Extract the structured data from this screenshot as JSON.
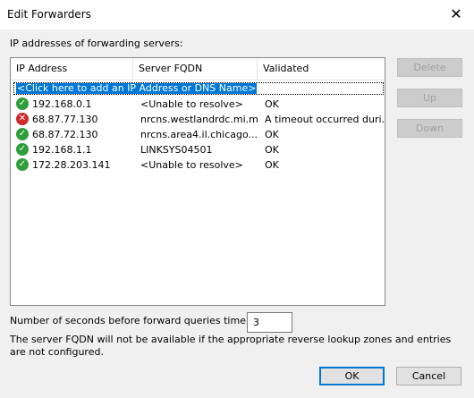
{
  "window": {
    "title": "Edit Forwarders",
    "close_glyph": "✕"
  },
  "caption": "IP addresses of forwarding servers:",
  "columns": [
    "IP Address",
    "Server FQDN",
    "Validated"
  ],
  "add_row": "<Click here to add an IP Address or DNS Name>",
  "rows": [
    {
      "status": "ok-icon",
      "ip": "192.168.0.1",
      "fqdn": "<Unable to resolve>",
      "validated": "OK"
    },
    {
      "status": "error-icon",
      "ip": "68.87.77.130",
      "fqdn": "nrcns.westlandrdc.mi.m...",
      "validated": "A timeout occurred duri..."
    },
    {
      "status": "ok-icon",
      "ip": "68.87.72.130",
      "fqdn": "nrcns.area4.il.chicago....",
      "validated": "OK"
    },
    {
      "status": "ok-icon",
      "ip": "192.168.1.1",
      "fqdn": "LINKSYS04501",
      "validated": "OK"
    },
    {
      "status": "ok-icon",
      "ip": "172.28.203.141",
      "fqdn": "<Unable to resolve>",
      "validated": "OK"
    }
  ],
  "buttons": {
    "delete": "Delete",
    "up": "Up",
    "down": "Down",
    "ok": "OK",
    "cancel": "Cancel"
  },
  "timeout": {
    "label": "Number of seconds before forward queries time out:",
    "value": "3"
  },
  "note": "The server FQDN will not be available if the appropriate reverse lookup zones and entries are not configured.",
  "colors": {
    "selection": "#0078d7",
    "ok": "#2e9e3a",
    "error": "#d0282a"
  }
}
